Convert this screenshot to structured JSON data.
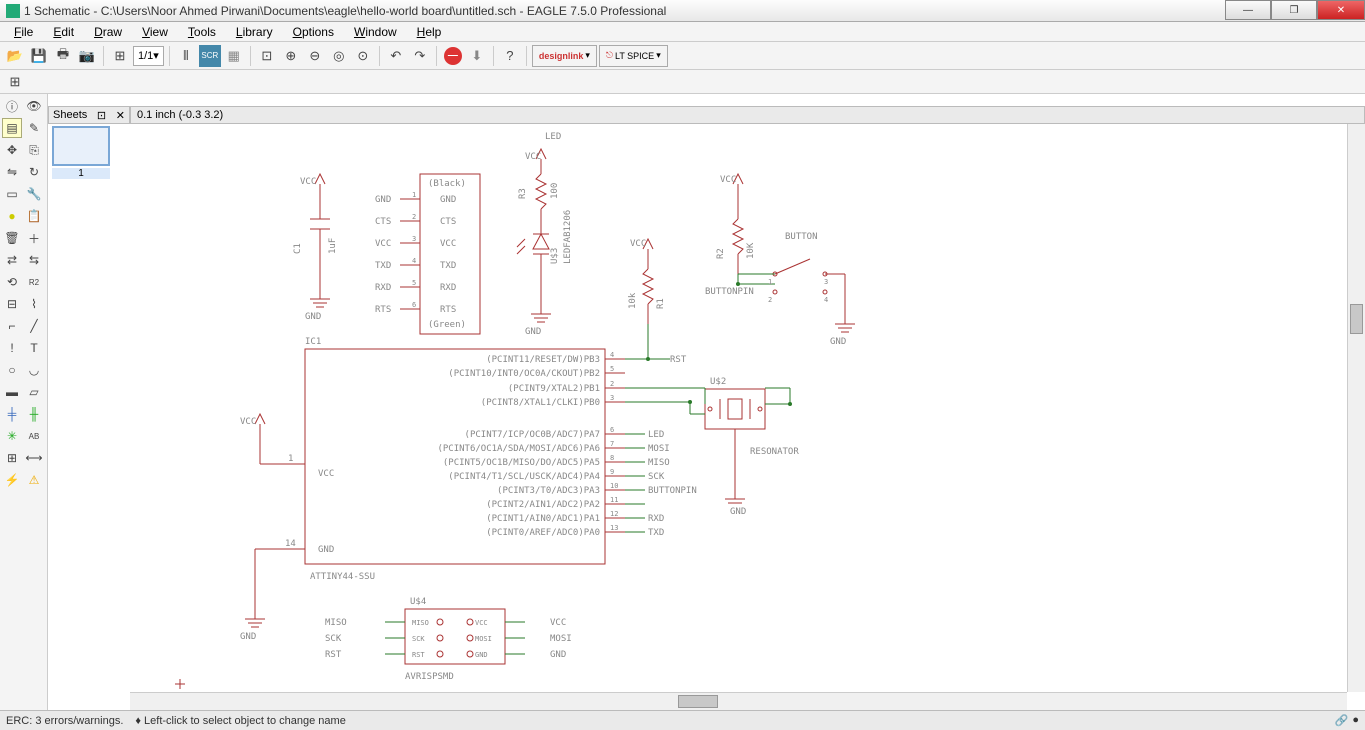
{
  "title": "1 Schematic - C:\\Users\\Noor Ahmed Pirwani\\Documents\\eagle\\hello-world board\\untitled.sch - EAGLE 7.5.0 Professional",
  "menu": {
    "file": "File",
    "edit": "Edit",
    "draw": "Draw",
    "view": "View",
    "tools": "Tools",
    "library": "Library",
    "options": "Options",
    "window": "Window",
    "help": "Help"
  },
  "toolbar": {
    "layer": "1/1",
    "designlink": "designlink",
    "spice": "LT SPICE"
  },
  "sheets": {
    "title": "Sheets",
    "num": "1"
  },
  "coord": "0.1 inch (-0.3 3.2)",
  "status": {
    "erc": "ERC: 3 errors/warnings.",
    "hint": "♦ Left-click to select object to change name"
  },
  "sch": {
    "ic1": "IC1",
    "ic1part": "ATTINY44-SSU",
    "vcc": "VCC",
    "gnd": "GND",
    "c1": "C1",
    "c1v": "1uF",
    "ftdi_top": "(Black)",
    "ftdi_bot": "(Green)",
    "ftdi": [
      "GND",
      "CTS",
      "VCC",
      "TXD",
      "RXD",
      "RTS"
    ],
    "ftdi_lbl": [
      "GND",
      "CTS",
      "VCC",
      "TXD",
      "RXD",
      "RTS"
    ],
    "led": "LED",
    "r3": "R3",
    "r3v": "100",
    "ledpart": "LEDFAB1206",
    "u3": "U$3",
    "r1": "R1",
    "r1v": "10k",
    "rst": "RST",
    "r2": "R2",
    "r2v": "10K",
    "button": "BUTTON",
    "buttonpin": "BUTTONPIN",
    "u2": "U$2",
    "resonator": "RESONATOR",
    "u4": "U$4",
    "isp": "AVRISPSMD",
    "isp_l": [
      "MISO",
      "SCK",
      "RST"
    ],
    "isp_r": [
      "VCC",
      "MOSI",
      "GND"
    ],
    "miso": "MISO",
    "sck": "SCK",
    "mosi": "MOSI",
    "txd": "TXD",
    "rxd": "RXD",
    "pins_left": {
      "1": "1",
      "14": "14"
    },
    "pins_right": [
      "PB3",
      "PB2",
      "PB1",
      "PB0",
      "PA7",
      "PA6",
      "PA5",
      "PA4",
      "PA3",
      "PA2",
      "PA1",
      "PA0"
    ],
    "pinfunc": [
      "(PCINT11/RESET/DW)PB3",
      "(PCINT10/INT0/OC0A/CKOUT)PB2",
      "(PCINT9/XTAL2)PB1",
      "(PCINT8/XTAL1/CLKI)PB0",
      "(PCINT7/ICP/OC0B/ADC7)PA7",
      "(PCINT6/OC1A/SDA/MOSI/ADC6)PA6",
      "(PCINT5/OC1B/MISO/DO/ADC5)PA5",
      "(PCINT4/T1/SCL/USCK/ADC4)PA4",
      "(PCINT3/T0/ADC3)PA3",
      "(PCINT2/AIN1/ADC2)PA2",
      "(PCINT1/AIN0/ADC1)PA1",
      "(PCINT0/AREF/ADC0)PA0"
    ],
    "pinnum_r": [
      "4",
      "5",
      "2",
      "3",
      "6",
      "7",
      "8",
      "9",
      "10",
      "11",
      "12",
      "13"
    ],
    "netlabels": [
      "LED",
      "MOSI",
      "MISO",
      "SCK",
      "BUTTONPIN",
      "",
      "RXD",
      "TXD"
    ]
  }
}
